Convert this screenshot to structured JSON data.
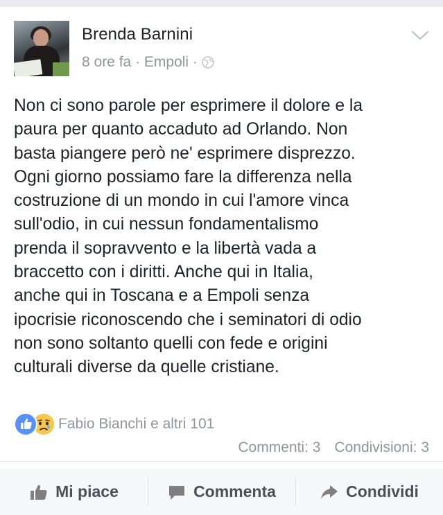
{
  "post": {
    "author": "Brenda Barnini",
    "time": "8 ore fa",
    "location": "Empoli",
    "separator": "·",
    "text_lines": [
      "Non ci sono parole per esprimere il dolore e la",
      "paura per quanto accaduto ad Orlando. Non",
      "basta piangere però ne' esprimere disprezzo.",
      "Ogni giorno possiamo fare la differenza nella",
      "costruzione di un mondo in cui l'amore vinca",
      "sull'odio, in cui nessun fondamentalismo",
      "prenda il sopravvento e la libertà vada a",
      "braccetto con i diritti. Anche qui in Italia,",
      "anche qui in Toscana e a Empoli senza",
      "ipocrisie riconoscendo che i seminatori di odio",
      "non sono soltanto quelli con fede e origini",
      "culturali diverse da quelle cristiane."
    ]
  },
  "reactions": {
    "names": "Fabio Bianchi e altri 101",
    "icons": [
      "like-reaction-icon",
      "sad-reaction-icon"
    ]
  },
  "counts": {
    "comments": "Commenti: 3",
    "shares": "Condivisioni: 3"
  },
  "actions": {
    "like": "Mi piace",
    "comment": "Commenta",
    "share": "Condividi"
  },
  "colors": {
    "meta_text": "#90949c",
    "like_blue": "#5890ff",
    "action_text": "#4b4f56",
    "action_bar_bg": "#f6f7f9"
  }
}
